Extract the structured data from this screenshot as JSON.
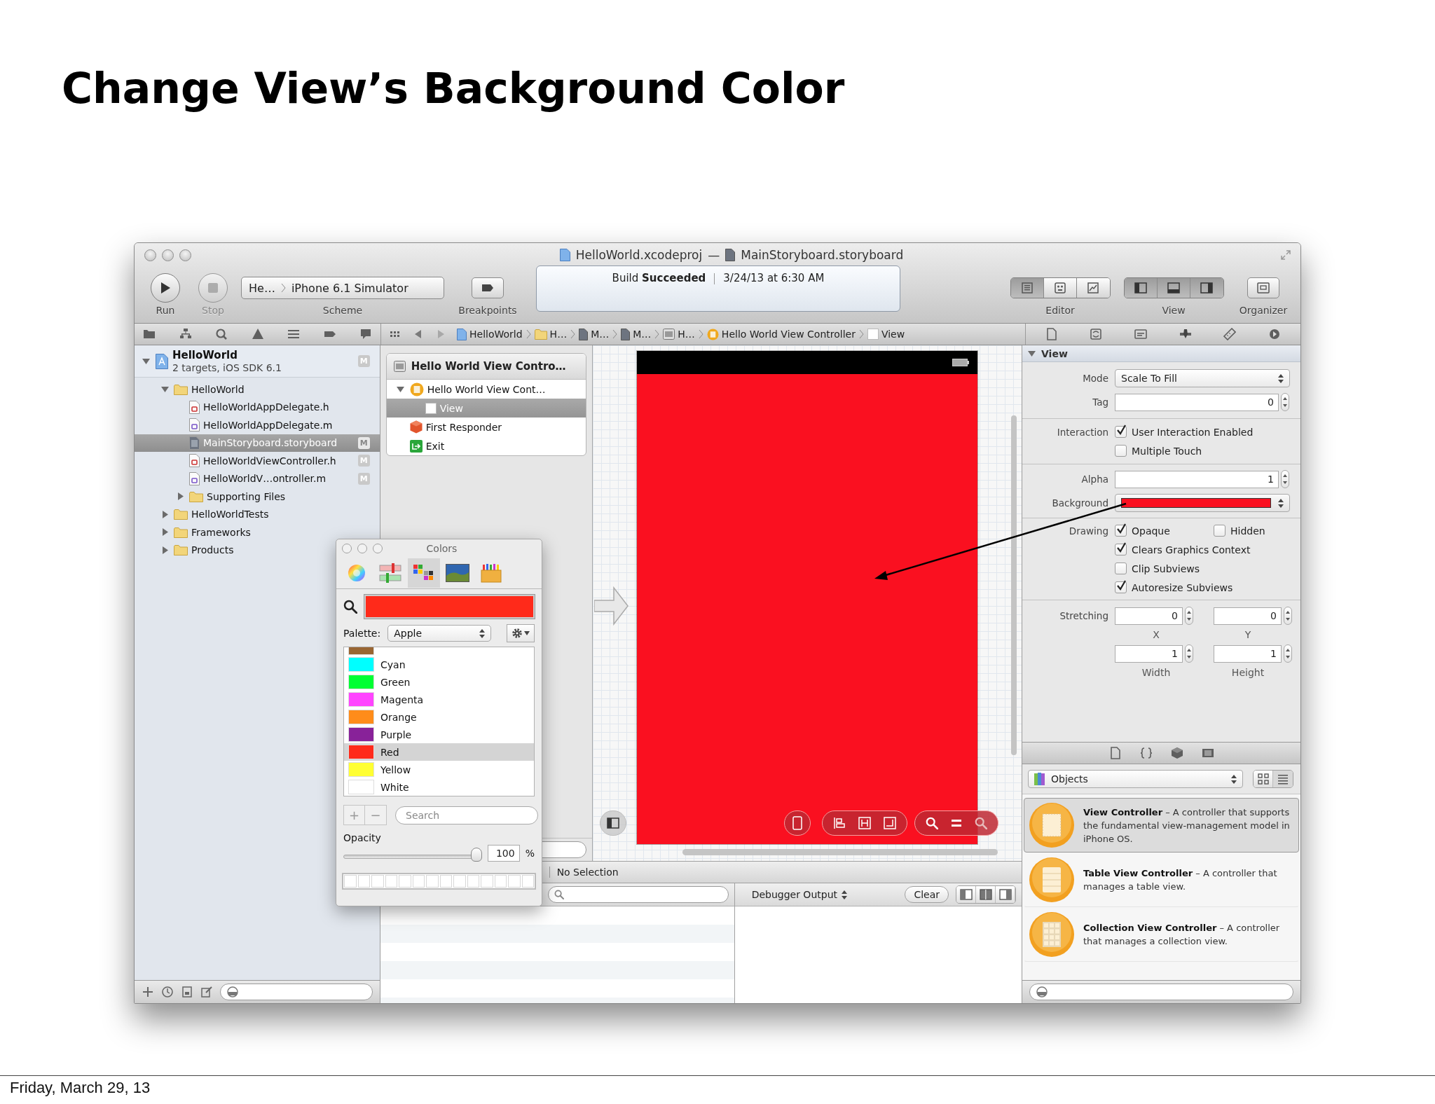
{
  "slide": {
    "title": "Change View’s Background Color",
    "footer": "Friday, March 29, 13"
  },
  "window": {
    "title_project": "HelloWorld.xcodeproj",
    "title_separator": "—",
    "title_file": "MainStoryboard.storyboard"
  },
  "toolbar": {
    "run": "Run",
    "stop": "Stop",
    "scheme_target": "He…",
    "scheme_device": "iPhone 6.1 Simulator",
    "scheme": "Scheme",
    "breakpoints": "Breakpoints",
    "activity": "Build **Succeeded**",
    "activity_time": "3/24/13 at 6:30 AM",
    "editor": "Editor",
    "editor_modes": [
      {
        "kind": "standard",
        "selected": true
      },
      {
        "kind": "assistant",
        "selected": false
      },
      {
        "kind": "version",
        "selected": false
      }
    ],
    "view": "View",
    "view_toggles": [
      {
        "kind": "left",
        "selected": true
      },
      {
        "kind": "bottom",
        "selected": true
      },
      {
        "kind": "right",
        "selected": true
      }
    ],
    "organizer": "Organizer"
  },
  "jump_bar": [
    {
      "label": "HelloWorld",
      "kind": "project"
    },
    {
      "label": "H…",
      "kind": "folder"
    },
    {
      "label": "M…",
      "kind": "file"
    },
    {
      "label": "M…",
      "kind": "file"
    },
    {
      "label": "H…",
      "kind": "scene"
    },
    {
      "label": "Hello World View Controller",
      "kind": "controller"
    },
    {
      "label": "View",
      "kind": "view"
    }
  ],
  "navigator": {
    "project": {
      "name": "HelloWorld",
      "subtitle": "2 targets, iOS SDK 6.1",
      "badge": "M",
      "expanded": true
    },
    "items": [
      {
        "name": "HelloWorld",
        "kind": "folder",
        "selected": false,
        "expanded": true,
        "children": [
          {
            "name": "HelloWorldAppDelegate.h",
            "kind": "h",
            "selected": false
          },
          {
            "name": "HelloWorldAppDelegate.m",
            "kind": "m",
            "selected": false
          },
          {
            "name": "MainStoryboard.storyboard",
            "kind": "storyboard",
            "selected": true,
            "badge": "M"
          },
          {
            "name": "HelloWorldViewController.h",
            "kind": "h",
            "selected": false,
            "badge": "M"
          },
          {
            "name": "HelloWorldV…ontroller.m",
            "kind": "m",
            "selected": false,
            "badge": "M"
          },
          {
            "name": "Supporting Files",
            "kind": "folder",
            "selected": false,
            "expanded": false
          }
        ]
      },
      {
        "name": "HelloWorldTests",
        "kind": "folder",
        "selected": false,
        "expanded": false
      },
      {
        "name": "Frameworks",
        "kind": "folder",
        "selected": false,
        "expanded": false
      },
      {
        "name": "Products",
        "kind": "folder",
        "selected": false,
        "expanded": false
      }
    ]
  },
  "outline": {
    "header": "Hello World View Contro…",
    "items": [
      {
        "name": "Hello World View Cont…",
        "kind": "controller",
        "selected": false,
        "expanded": true,
        "children": [
          {
            "name": "View",
            "kind": "view",
            "selected": true
          }
        ]
      },
      {
        "name": "First Responder",
        "kind": "responder",
        "selected": false
      },
      {
        "name": "Exit",
        "kind": "exit",
        "selected": false
      }
    ]
  },
  "colors_panel": {
    "title": "Colors",
    "modes": [
      {
        "kind": "wheel",
        "selected": false
      },
      {
        "kind": "sliders",
        "selected": false
      },
      {
        "kind": "palettes",
        "selected": true
      },
      {
        "kind": "image",
        "selected": false
      },
      {
        "kind": "crayons",
        "selected": false
      }
    ],
    "palette_label": "Palette:",
    "palette": "Apple",
    "colors": [
      {
        "name": "Cyan",
        "color": "#00ffff",
        "selected": false
      },
      {
        "name": "Green",
        "color": "#00ff33",
        "selected": false
      },
      {
        "name": "Magenta",
        "color": "#ff44ff",
        "selected": false
      },
      {
        "name": "Orange",
        "color": "#ff8c1a",
        "selected": false
      },
      {
        "name": "Purple",
        "color": "#882299",
        "selected": false
      },
      {
        "name": "Red",
        "color": "#ff2a1a",
        "selected": true
      },
      {
        "name": "Yellow",
        "color": "#ffff33",
        "selected": false
      },
      {
        "name": "White",
        "color": "#ffffff",
        "selected": false
      }
    ],
    "add": "+",
    "remove": "−",
    "search_placeholder": "Search",
    "opacity": {
      "label": "Opacity",
      "level": 1,
      "value": "100",
      "unit": "%"
    }
  },
  "debug": {
    "status": "No Selection",
    "output": "Debugger Output",
    "clear": "Clear"
  },
  "inspector": {
    "section": "View",
    "expanded": true,
    "mode_label": "Mode",
    "mode": "Scale To Fill",
    "tag_label": "Tag",
    "tag": "0",
    "interaction_label": "Interaction",
    "interaction": [
      {
        "label": "User Interaction Enabled",
        "checked": true
      },
      {
        "label": "Multiple Touch",
        "checked": false
      }
    ],
    "alpha_label": "Alpha",
    "alpha": "1",
    "background_label": "Background",
    "drawing_label": "Drawing",
    "drawing": [
      {
        "label": "Opaque",
        "checked": true
      },
      {
        "label": "Hidden",
        "checked": false
      },
      {
        "label": "Clears Graphics Context",
        "checked": true
      },
      {
        "label": "Clip Subviews",
        "checked": false
      },
      {
        "label": "Autoresize Subviews",
        "checked": true
      }
    ],
    "stretching_label": "Stretching",
    "stretching": [
      {
        "value": "0",
        "label": "X"
      },
      {
        "value": "0",
        "label": "Y"
      },
      {
        "value": "1",
        "label": "Width"
      },
      {
        "value": "1",
        "label": "Height"
      }
    ]
  },
  "library": {
    "filter": "Objects",
    "items": [
      {
        "text": "**View Controller** – A controller that supports the fundamental view-management model in iPhone OS.",
        "kind": "view-controller",
        "selected": true
      },
      {
        "text": "**Table View Controller** – A controller that manages a table view.",
        "kind": "table-view-controller",
        "selected": false
      },
      {
        "text": "**Collection View Controller** – A controller that manages a collection view.",
        "kind": "collection-view-controller",
        "selected": false
      }
    ]
  }
}
